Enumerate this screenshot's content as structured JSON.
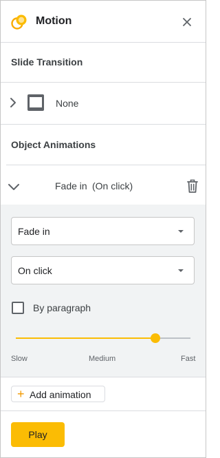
{
  "panel": {
    "title": "Motion",
    "logo_icon": "motion-logo-icon",
    "close_icon": "close-icon",
    "accent": "#fbbc04"
  },
  "slide_transition": {
    "heading": "Slide Transition",
    "value": "None",
    "expand_icon": "chevron-right-icon",
    "thumb_icon": "slide-thumbnail-icon"
  },
  "object_animations": {
    "heading": "Object Animations",
    "item": {
      "name": "Fade in",
      "trigger": "(On click)",
      "collapse_icon": "chevron-down-icon",
      "delete_icon": "trash-icon"
    },
    "effect_select": {
      "value": "Fade in"
    },
    "trigger_select": {
      "value": "On click"
    },
    "by_paragraph": {
      "label": "By paragraph",
      "checked": false
    },
    "speed": {
      "labels": [
        "Slow",
        "Medium",
        "Fast"
      ],
      "value": 0.8
    }
  },
  "add_animation": {
    "label": "Add animation",
    "icon": "plus-icon"
  },
  "play": {
    "label": "Play"
  }
}
